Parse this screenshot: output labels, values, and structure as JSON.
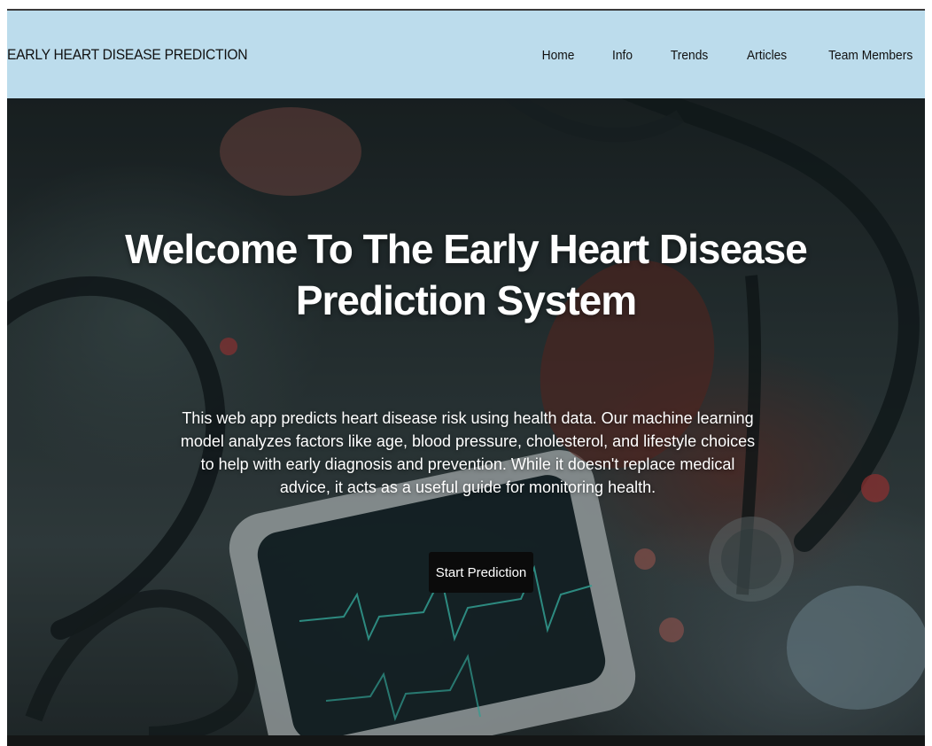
{
  "navbar": {
    "brand": "EARLY HEART DISEASE PREDICTION",
    "links": [
      "Home",
      "Info",
      "Trends",
      "Articles",
      "Team Members"
    ]
  },
  "hero": {
    "title_line1": "Welcome To The Early Heart Disease",
    "title_line2": "Prediction System",
    "description": "This web app predicts heart disease risk using health data. Our machine learning model analyzes factors like age, blood pressure, cholesterol, and lifestyle choices to help with early diagnosis and prevention. While it doesn't replace medical advice, it acts as a useful guide for monitoring health.",
    "cta_label": "Start Prediction"
  },
  "colors": {
    "navbar_bg": "#bcdcec",
    "cta_bg": "#0b0b0b",
    "hero_text": "#ffffff"
  }
}
